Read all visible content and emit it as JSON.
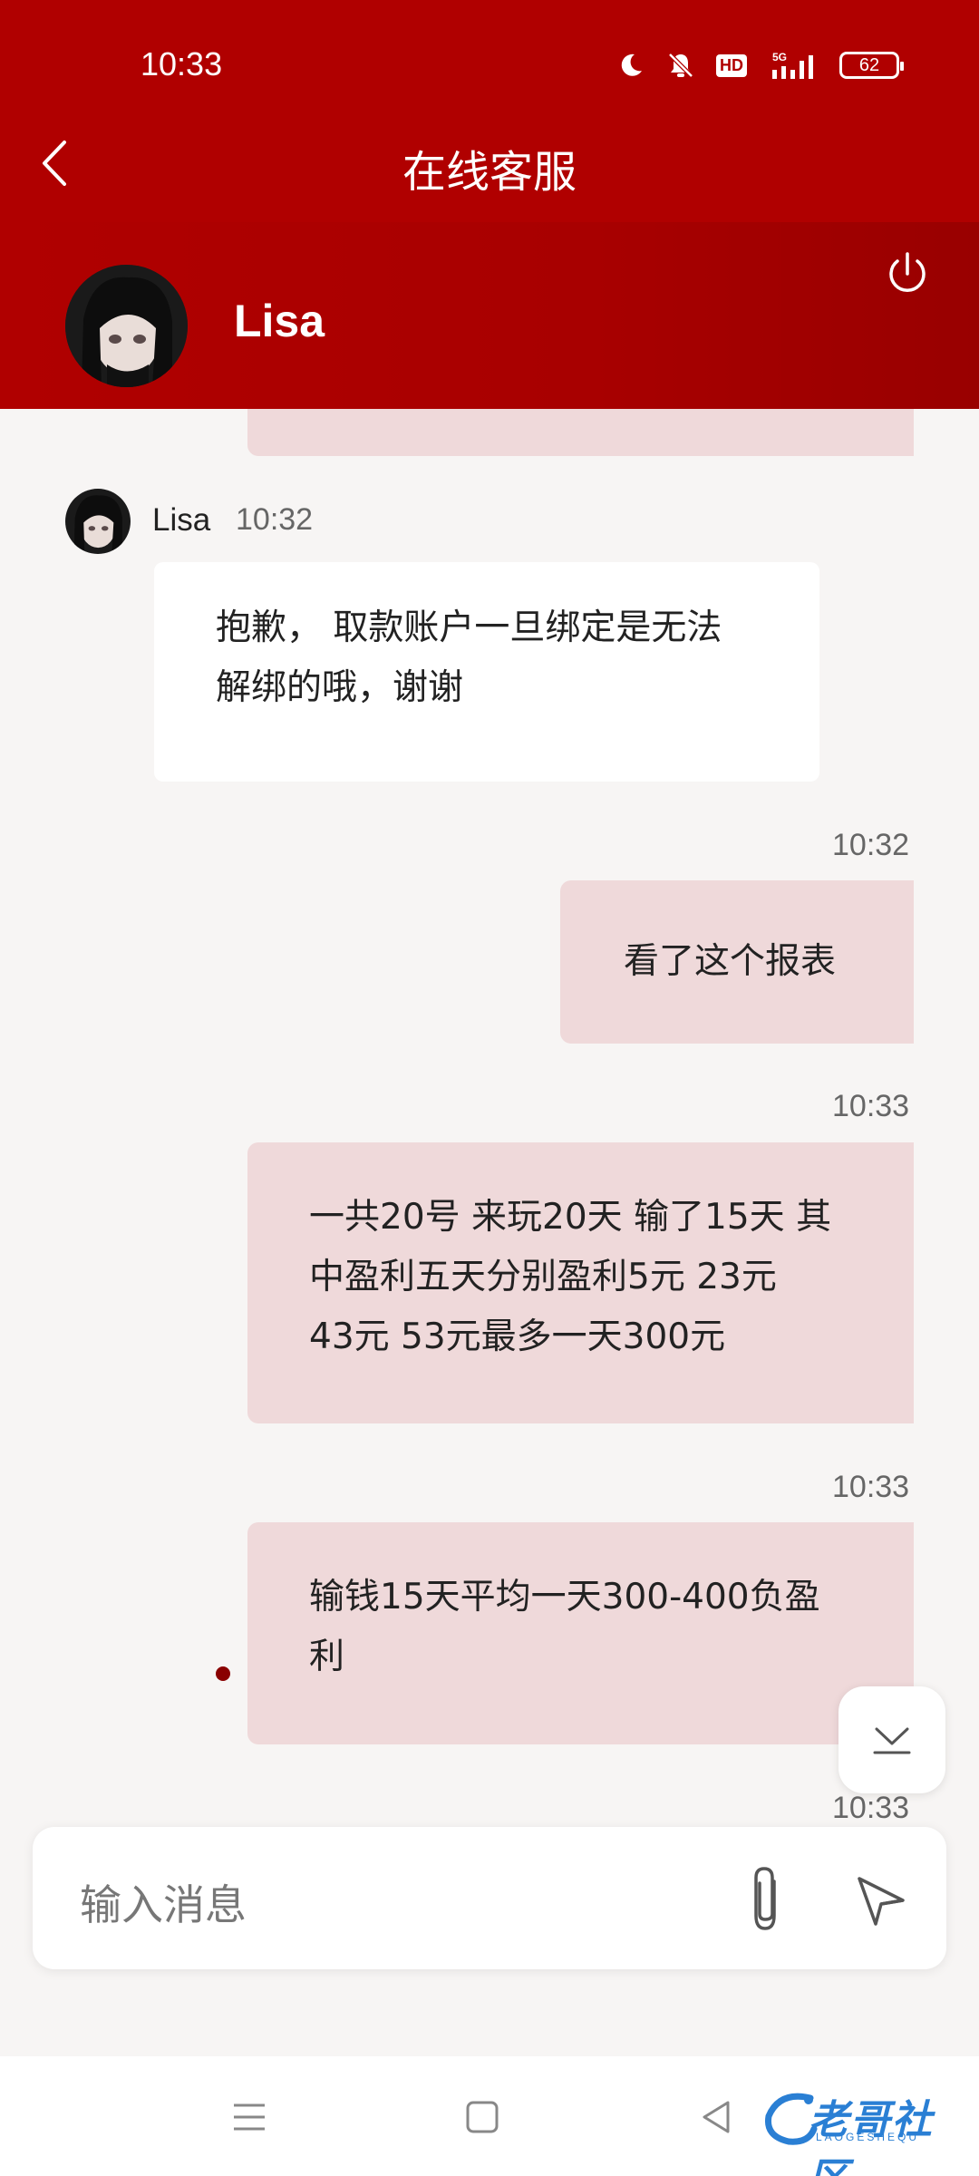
{
  "status_bar": {
    "time": "10:33",
    "network": "5G",
    "hd_label": "HD",
    "battery": "62"
  },
  "header": {
    "title": "在线客服"
  },
  "agent": {
    "name": "Lisa"
  },
  "messages": [
    {
      "direction": "incoming",
      "sender": "Lisa",
      "time": "10:32",
      "text_lines": [
        "抱歉， 取款账户一旦绑定是无法",
        "解绑的哦，谢谢"
      ]
    },
    {
      "direction": "outgoing",
      "time": "10:32",
      "text_lines": [
        "看了这个报表"
      ]
    },
    {
      "direction": "outgoing",
      "time": "10:33",
      "text_lines": [
        "一共20号 来玩20天 输了15天 其",
        "中盈利五天分别盈利5元 23元",
        "43元 53元最多一天300元"
      ]
    },
    {
      "direction": "outgoing",
      "time": "10:33",
      "text_lines": [
        "输钱15天平均一天300-400负盈",
        "利"
      ]
    },
    {
      "direction": "outgoing",
      "time": "10:33",
      "text_lines": []
    }
  ],
  "input": {
    "placeholder": "输入消息"
  },
  "watermark": {
    "text": "老哥社区",
    "sub": "LAOGESHEQU"
  },
  "colors": {
    "header_red": "#b00000",
    "outgoing_bubble": "#efd9da",
    "incoming_bubble": "#ffffff",
    "background": "#f7f5f4"
  }
}
